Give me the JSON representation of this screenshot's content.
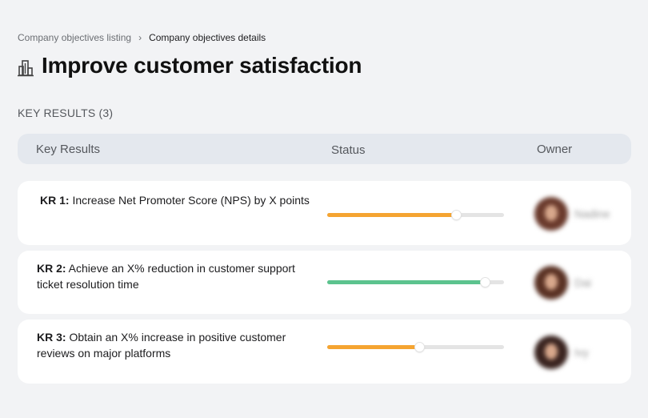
{
  "breadcrumb": {
    "parent": "Company objectives listing",
    "separator": "›",
    "current": "Company objectives details"
  },
  "page": {
    "icon": "building-icon",
    "title": "Improve customer satisfaction"
  },
  "section": {
    "label": "KEY RESULTS (3)"
  },
  "table": {
    "columns": {
      "key_results": "Key Results",
      "status": "Status",
      "owner": "Owner"
    }
  },
  "key_results": [
    {
      "id": "KR 1:",
      "text": " Increase Net Promoter Score (NPS) by X points",
      "progress": 0.73,
      "color": "#f5a431",
      "owner": "Nadine"
    },
    {
      "id": "KR 2:",
      "text": " Achieve an X% reduction in customer support ticket resolution time",
      "progress": 0.89,
      "color": "#5cc38e",
      "owner": "Dai"
    },
    {
      "id": "KR 3:",
      "text": " Obtain an X% increase in positive customer reviews on major platforms",
      "progress": 0.52,
      "color": "#f5a431",
      "owner": "Ivy"
    }
  ]
}
